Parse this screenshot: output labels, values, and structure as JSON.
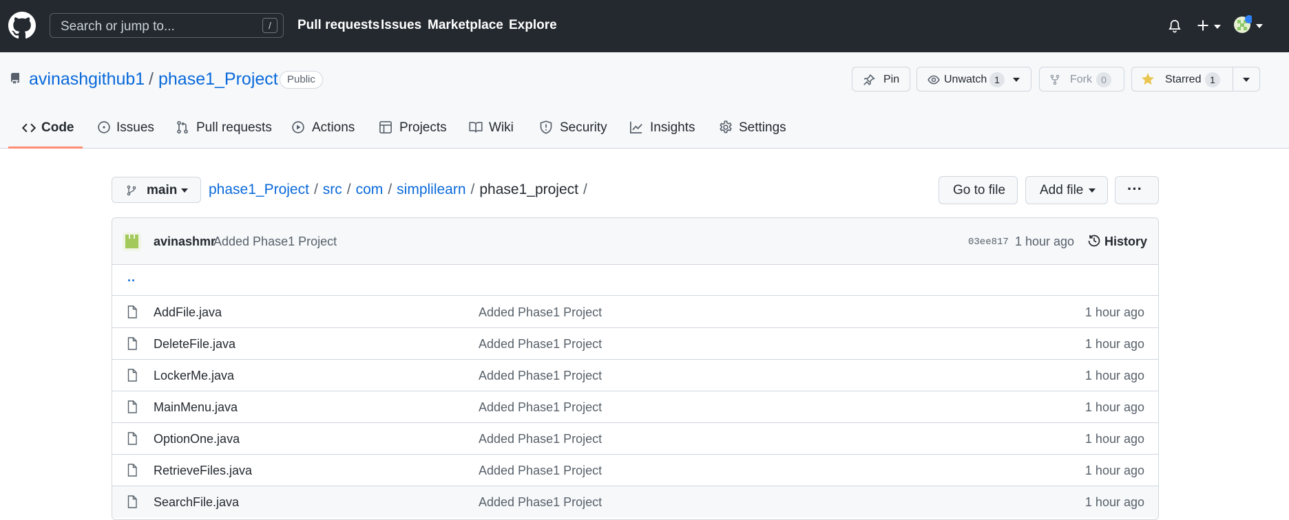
{
  "topbar": {
    "search_placeholder": "Search or jump to...",
    "search_shortcut": "/",
    "nav": [
      "Pull requests",
      "Issues",
      "Marketplace",
      "Explore"
    ]
  },
  "repo": {
    "owner": "avinashgithub1",
    "separator": "/",
    "name": "phase1_Project",
    "visibility": "Public",
    "actions": {
      "pin_label": "Pin",
      "unwatch_label": "Unwatch",
      "unwatch_count": "1",
      "fork_label": "Fork",
      "fork_count": "0",
      "starred_label": "Starred",
      "starred_count": "1"
    }
  },
  "tabs": [
    {
      "label": "Code",
      "icon": "code-icon",
      "selected": true
    },
    {
      "label": "Issues",
      "icon": "issue-icon"
    },
    {
      "label": "Pull requests",
      "icon": "pull-request-icon"
    },
    {
      "label": "Actions",
      "icon": "play-icon"
    },
    {
      "label": "Projects",
      "icon": "table-icon"
    },
    {
      "label": "Wiki",
      "icon": "book-icon"
    },
    {
      "label": "Security",
      "icon": "shield-icon"
    },
    {
      "label": "Insights",
      "icon": "graph-icon"
    },
    {
      "label": "Settings",
      "icon": "gear-icon"
    }
  ],
  "branch": {
    "name": "main"
  },
  "breadcrumb": {
    "parts": [
      "phase1_Project",
      "src",
      "com",
      "simplilearn"
    ],
    "current": "phase1_project",
    "trailing": "/"
  },
  "file_actions": {
    "go_to_file": "Go to file",
    "add_file": "Add file",
    "more": "···"
  },
  "latest_commit": {
    "author": "avinashmr",
    "message": "Added Phase1 Project",
    "sha": "03ee817",
    "time": "1 hour ago",
    "history_label": "History"
  },
  "parent_dir": "..",
  "files": [
    {
      "name": "AddFile.java",
      "message": "Added Phase1 Project",
      "time": "1 hour ago"
    },
    {
      "name": "DeleteFile.java",
      "message": "Added Phase1 Project",
      "time": "1 hour ago"
    },
    {
      "name": "LockerMe.java",
      "message": "Added Phase1 Project",
      "time": "1 hour ago"
    },
    {
      "name": "MainMenu.java",
      "message": "Added Phase1 Project",
      "time": "1 hour ago"
    },
    {
      "name": "OptionOne.java",
      "message": "Added Phase1 Project",
      "time": "1 hour ago"
    },
    {
      "name": "RetrieveFiles.java",
      "message": "Added Phase1 Project",
      "time": "1 hour ago"
    },
    {
      "name": "SearchFile.java",
      "message": "Added Phase1 Project",
      "time": "1 hour ago"
    }
  ],
  "colors": {
    "link": "#0969da",
    "header_bg": "#24292f",
    "tab_underline": "#fd8c73",
    "star": "#eac54f"
  }
}
